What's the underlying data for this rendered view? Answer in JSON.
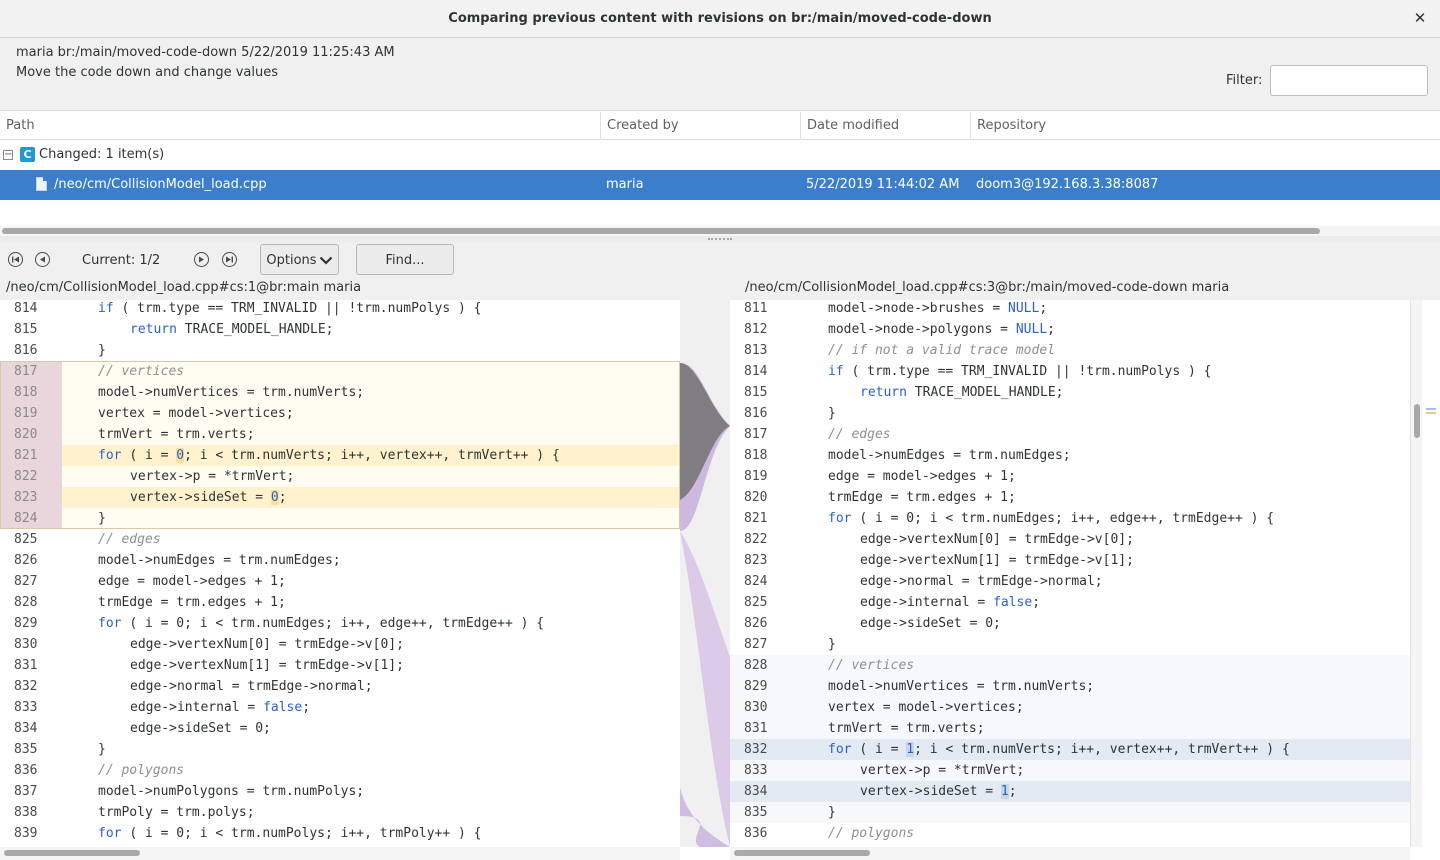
{
  "window": {
    "title": "Comparing previous content with revisions on br:/main/moved-code-down",
    "close_icon": "close-icon"
  },
  "changeset": {
    "header": "maria br:/main/moved-code-down 5/22/2019 11:25:43 AM",
    "comment": "Move the code down and change values"
  },
  "filter": {
    "label": "Filter:",
    "value": ""
  },
  "table": {
    "columns": [
      "Path",
      "Created by",
      "Date modified",
      "Repository"
    ],
    "group": {
      "badge": "C",
      "label": "Changed: 1 item(s)"
    },
    "rows": [
      {
        "path": "/neo/cm/CollisionModel_load.cpp",
        "created_by": "maria",
        "date_modified": "5/22/2019 11:44:02 AM",
        "repository": "doom3@192.168.3.38:8087"
      }
    ]
  },
  "toolbar": {
    "current": "Current: 1/2",
    "options_label": "Options",
    "find_label": "Find...",
    "nav_icons": [
      "first-diff-icon",
      "previous-diff-icon",
      "next-diff-icon",
      "last-diff-icon"
    ]
  },
  "left": {
    "path": "/neo/cm/CollisionModel_load.cpp#cs:1@br:main maria",
    "lines": [
      {
        "n": "814",
        "indent": 1,
        "t": [
          [
            "kw",
            "if"
          ],
          [
            "",
            "( trm.type == TRM_INVALID || !trm.numPolys ) {"
          ]
        ]
      },
      {
        "n": "815",
        "indent": 2,
        "t": [
          [
            "kw",
            "return"
          ],
          [
            "",
            "TRACE_MODEL_HANDLE;"
          ]
        ]
      },
      {
        "n": "816",
        "indent": 1,
        "t": [
          [
            "",
            "}"
          ]
        ]
      },
      {
        "n": "817",
        "indent": 1,
        "t": [
          [
            "cm",
            "// vertices"
          ]
        ],
        "hl": "block"
      },
      {
        "n": "818",
        "indent": 1,
        "t": [
          [
            "",
            "model->numVertices = trm.numVerts;"
          ]
        ],
        "hl": "block"
      },
      {
        "n": "819",
        "indent": 1,
        "t": [
          [
            "",
            "vertex = model->vertices;"
          ]
        ],
        "hl": "block"
      },
      {
        "n": "820",
        "indent": 1,
        "t": [
          [
            "",
            "trmVert = trm.verts;"
          ]
        ],
        "hl": "block"
      },
      {
        "n": "821",
        "indent": 1,
        "t": [
          [
            "kw",
            "for"
          ],
          [
            "",
            "( i = "
          ],
          [
            "lit",
            "0"
          ],
          [
            "",
            "; i < trm.numVerts; i++, vertex++, trmVert++ ) {"
          ]
        ],
        "hl": "changed"
      },
      {
        "n": "822",
        "indent": 2,
        "t": [
          [
            "",
            "vertex->p = *trmVert;"
          ]
        ],
        "hl": "block"
      },
      {
        "n": "823",
        "indent": 2,
        "t": [
          [
            "",
            "vertex->sideSet = "
          ],
          [
            "lit",
            "0"
          ],
          [
            "",
            ";"
          ]
        ],
        "hl": "changed"
      },
      {
        "n": "824",
        "indent": 1,
        "t": [
          [
            "",
            "}"
          ]
        ],
        "hl": "block"
      },
      {
        "n": "825",
        "indent": 1,
        "t": [
          [
            "cm",
            "// edges"
          ]
        ]
      },
      {
        "n": "826",
        "indent": 1,
        "t": [
          [
            "",
            "model->numEdges = trm.numEdges;"
          ]
        ]
      },
      {
        "n": "827",
        "indent": 1,
        "t": [
          [
            "",
            "edge = model->edges + 1;"
          ]
        ]
      },
      {
        "n": "828",
        "indent": 1,
        "t": [
          [
            "",
            "trmEdge = trm.edges + 1;"
          ]
        ]
      },
      {
        "n": "829",
        "indent": 1,
        "t": [
          [
            "kw",
            "for"
          ],
          [
            "",
            "( i = 0; i < trm.numEdges; i++, edge++, trmEdge++ ) {"
          ]
        ]
      },
      {
        "n": "830",
        "indent": 2,
        "t": [
          [
            "",
            "edge->vertexNum[0] = trmEdge->v[0];"
          ]
        ]
      },
      {
        "n": "831",
        "indent": 2,
        "t": [
          [
            "",
            "edge->vertexNum[1] = trmEdge->v[1];"
          ]
        ]
      },
      {
        "n": "832",
        "indent": 2,
        "t": [
          [
            "",
            "edge->normal = trmEdge->normal;"
          ]
        ]
      },
      {
        "n": "833",
        "indent": 2,
        "t": [
          [
            "",
            "edge->internal = "
          ],
          [
            "lit",
            "false"
          ],
          [
            "",
            ";"
          ]
        ]
      },
      {
        "n": "834",
        "indent": 2,
        "t": [
          [
            "",
            "edge->sideSet = 0;"
          ]
        ]
      },
      {
        "n": "835",
        "indent": 1,
        "t": [
          [
            "",
            "}"
          ]
        ]
      },
      {
        "n": "836",
        "indent": 1,
        "t": [
          [
            "cm",
            "// polygons"
          ]
        ]
      },
      {
        "n": "837",
        "indent": 1,
        "t": [
          [
            "",
            "model->numPolygons = trm.numPolys;"
          ]
        ]
      },
      {
        "n": "838",
        "indent": 1,
        "t": [
          [
            "",
            "trmPoly = trm.polys;"
          ]
        ]
      },
      {
        "n": "839",
        "indent": 1,
        "t": [
          [
            "kw",
            "for"
          ],
          [
            "",
            "( i = 0; i < trm.numPolys; i++, trmPoly++ ) {"
          ]
        ]
      }
    ]
  },
  "right": {
    "path": "/neo/cm/CollisionModel_load.cpp#cs:3@br:/main/moved-code-down maria",
    "lines": [
      {
        "n": "811",
        "indent": 1,
        "t": [
          [
            "",
            "model->node->brushes = "
          ],
          [
            "lit",
            "NULL"
          ],
          [
            "",
            ";"
          ]
        ]
      },
      {
        "n": "812",
        "indent": 1,
        "t": [
          [
            "",
            "model->node->polygons = "
          ],
          [
            "lit",
            "NULL"
          ],
          [
            "",
            ";"
          ]
        ]
      },
      {
        "n": "813",
        "indent": 1,
        "t": [
          [
            "cm",
            "// if not a valid trace model"
          ]
        ]
      },
      {
        "n": "814",
        "indent": 1,
        "t": [
          [
            "kw",
            "if"
          ],
          [
            "",
            "( trm.type == TRM_INVALID || !trm.numPolys ) {"
          ]
        ]
      },
      {
        "n": "815",
        "indent": 2,
        "t": [
          [
            "kw",
            "return"
          ],
          [
            "",
            "TRACE_MODEL_HANDLE;"
          ]
        ]
      },
      {
        "n": "816",
        "indent": 1,
        "t": [
          [
            "",
            "}"
          ]
        ]
      },
      {
        "n": "817",
        "indent": 1,
        "t": [
          [
            "cm",
            "// edges"
          ]
        ]
      },
      {
        "n": "818",
        "indent": 1,
        "t": [
          [
            "",
            "model->numEdges = trm.numEdges;"
          ]
        ]
      },
      {
        "n": "819",
        "indent": 1,
        "t": [
          [
            "",
            "edge = model->edges + 1;"
          ]
        ]
      },
      {
        "n": "820",
        "indent": 1,
        "t": [
          [
            "",
            "trmEdge = trm.edges + 1;"
          ]
        ]
      },
      {
        "n": "821",
        "indent": 1,
        "t": [
          [
            "kw",
            "for"
          ],
          [
            "",
            "( i = 0; i < trm.numEdges; i++, edge++, trmEdge++ ) {"
          ]
        ]
      },
      {
        "n": "822",
        "indent": 2,
        "t": [
          [
            "",
            "edge->vertexNum[0] = trmEdge->v[0];"
          ]
        ]
      },
      {
        "n": "823",
        "indent": 2,
        "t": [
          [
            "",
            "edge->vertexNum[1] = trmEdge->v[1];"
          ]
        ]
      },
      {
        "n": "824",
        "indent": 2,
        "t": [
          [
            "",
            "edge->normal = trmEdge->normal;"
          ]
        ]
      },
      {
        "n": "825",
        "indent": 2,
        "t": [
          [
            "",
            "edge->internal = "
          ],
          [
            "lit",
            "false"
          ],
          [
            "",
            ";"
          ]
        ]
      },
      {
        "n": "826",
        "indent": 2,
        "t": [
          [
            "",
            "edge->sideSet = 0;"
          ]
        ]
      },
      {
        "n": "827",
        "indent": 1,
        "t": [
          [
            "",
            "}"
          ]
        ]
      },
      {
        "n": "828",
        "indent": 1,
        "t": [
          [
            "cm",
            "// vertices"
          ]
        ],
        "hl": "moved"
      },
      {
        "n": "829",
        "indent": 1,
        "t": [
          [
            "",
            "model->numVertices = trm.numVerts;"
          ]
        ],
        "hl": "moved"
      },
      {
        "n": "830",
        "indent": 1,
        "t": [
          [
            "",
            "vertex = model->vertices;"
          ]
        ],
        "hl": "moved"
      },
      {
        "n": "831",
        "indent": 1,
        "t": [
          [
            "",
            "trmVert = trm.verts;"
          ]
        ],
        "hl": "moved"
      },
      {
        "n": "832",
        "indent": 1,
        "t": [
          [
            "kw",
            "for"
          ],
          [
            "",
            "( i = "
          ],
          [
            "lit",
            "1"
          ],
          [
            "",
            "; i < trm.numVerts; i++, vertex++, trmVert++ ) {"
          ]
        ],
        "hl": "moved-changed"
      },
      {
        "n": "833",
        "indent": 2,
        "t": [
          [
            "",
            "vertex->p = *trmVert;"
          ]
        ],
        "hl": "moved"
      },
      {
        "n": "834",
        "indent": 2,
        "t": [
          [
            "",
            "vertex->sideSet = "
          ],
          [
            "lit",
            "1"
          ],
          [
            "",
            ";"
          ]
        ],
        "hl": "moved-changed"
      },
      {
        "n": "835",
        "indent": 1,
        "t": [
          [
            "",
            "}"
          ]
        ],
        "hl": "moved"
      },
      {
        "n": "836",
        "indent": 1,
        "t": [
          [
            "cm",
            "// polygons"
          ]
        ]
      }
    ]
  },
  "colors": {
    "selection": "#3b7fcc",
    "block_bg": "#fffcf2",
    "block_gutter": "#e8d6dc",
    "changed_bg": "#fff2cc",
    "moved_bg": "#f6f8fb",
    "moved_changed_bg": "#e3eaf3",
    "keyword": "#2a62c9",
    "comment": "#8f8f8f",
    "connector_dark": "#777777",
    "connector_purple": "#c9b3dd"
  }
}
